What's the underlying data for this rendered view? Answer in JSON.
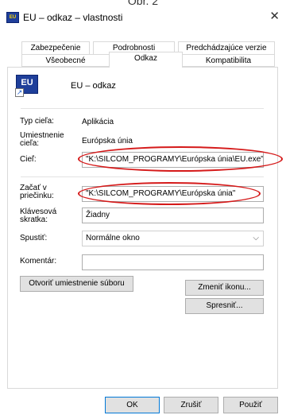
{
  "caption": "Obr. 2",
  "window": {
    "icon_text": "EU",
    "title": "EU – odkaz – vlastnosti",
    "close_glyph": "✕"
  },
  "tabs": {
    "row1": [
      "Zabezpečenie",
      "Podrobnosti",
      "Predchádzajúce verzie"
    ],
    "row2": [
      "Všeobecné",
      "Odkaz",
      "Kompatibilita"
    ],
    "active": "Odkaz"
  },
  "shortcut": {
    "icon_text": "EU",
    "arrow_glyph": "↗",
    "name": "EU – odkaz"
  },
  "fields": {
    "target_type_label": "Typ cieľa:",
    "target_type_value": "Aplikácia",
    "target_location_label": "Umiestnenie cieľa:",
    "target_location_value": "Európska únia",
    "target_label": "Cieľ:",
    "target_value": "\"K:\\SILCOM_PROGRAMY\\Európska únia\\EU.exe\"",
    "start_in_label": "Začať v priečinku:",
    "start_in_value": "\"K:\\SILCOM_PROGRAMY\\Európska únia\"",
    "shortcut_key_label": "Klávesová skratka:",
    "shortcut_key_value": "Žiadny",
    "run_label": "Spustiť:",
    "run_value": "Normálne okno",
    "run_arrow": "⌵",
    "comment_label": "Komentár:",
    "comment_value": ""
  },
  "buttons": {
    "open_location": "Otvoriť umiestnenie súboru",
    "change_icon": "Zmeniť ikonu...",
    "advanced": "Spresniť...",
    "ok": "OK",
    "cancel": "Zrušiť",
    "apply": "Použiť"
  },
  "colors": {
    "highlight_ellipse": "#d51a1a",
    "default_button_border": "#0078d7"
  }
}
